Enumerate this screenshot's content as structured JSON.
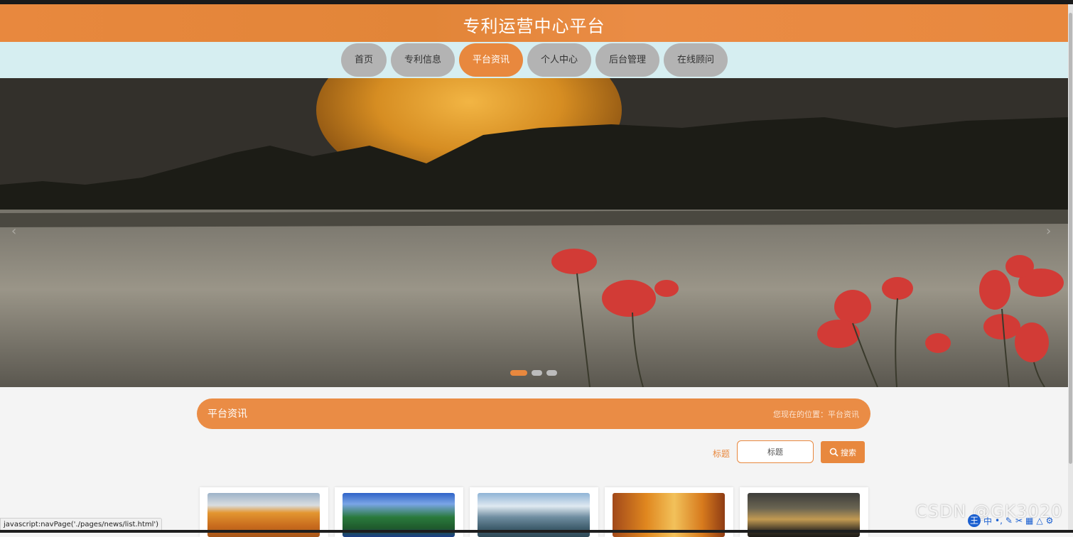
{
  "header": {
    "title": "专利运营中心平台"
  },
  "nav": {
    "items": [
      {
        "label": "首页",
        "active": false
      },
      {
        "label": "专利信息",
        "active": false
      },
      {
        "label": "平台资讯",
        "active": true
      },
      {
        "label": "个人中心",
        "active": false
      },
      {
        "label": "后台管理",
        "active": false
      },
      {
        "label": "在线顾问",
        "active": false
      }
    ]
  },
  "carousel": {
    "prev_icon": "chevron-left-icon",
    "next_icon": "chevron-right-icon",
    "active_slide": 1,
    "slide_count": 3
  },
  "section": {
    "title": "平台资讯",
    "breadcrumb": "您现在的位置：平台资讯"
  },
  "search": {
    "label": "标题",
    "placeholder": "标题",
    "button_label": "搜索",
    "button_icon": "search-icon"
  },
  "news_cards": [
    {
      "image": "autumn-bridge"
    },
    {
      "image": "green-island"
    },
    {
      "image": "mountain-lake"
    },
    {
      "image": "autumn-forest"
    },
    {
      "image": "lone-tree-sunset"
    }
  ],
  "status_bar": {
    "link": "javascript:navPage('./pages/news/list.html')"
  },
  "watermark": "CSDN @GK3020",
  "ime": {
    "mode": "中"
  },
  "colors": {
    "accent": "#e8883e",
    "nav_bg": "#d6eef1",
    "nav_inactive": "#b3b3b3"
  }
}
